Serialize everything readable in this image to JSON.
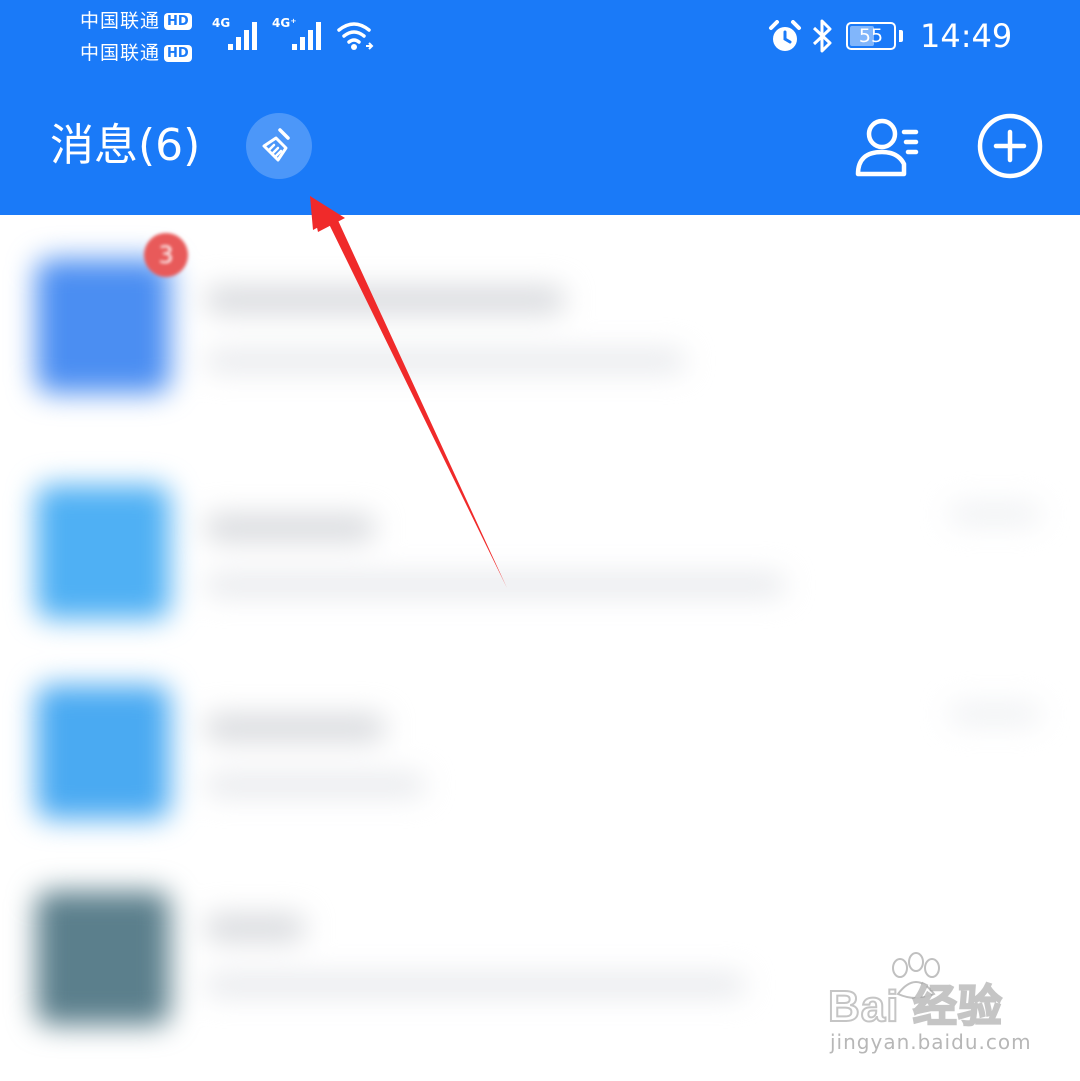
{
  "status_bar": {
    "carrier_1": "中国联通",
    "carrier_2": "中国联通",
    "hd_badge": "HD",
    "network_1": "4G",
    "network_2": "4G⁺",
    "battery_level": "55",
    "time": "14:49",
    "icons": [
      "signal-icon",
      "wifi-icon",
      "alarm-icon",
      "bluetooth-icon",
      "battery-icon"
    ]
  },
  "header": {
    "title": "消息(6)",
    "background_color": "#1a7af8",
    "buttons": {
      "clean": "broom-icon",
      "contacts": "contacts-icon",
      "add": "plus-circle-icon"
    }
  },
  "messages": {
    "first_unread_badge": "3",
    "badge_color": "#e85a5a"
  },
  "annotation": {
    "arrow_color": "#f02a2a"
  },
  "watermark": {
    "brand": "Bai  经验",
    "url": "jingyan.baidu.com"
  }
}
